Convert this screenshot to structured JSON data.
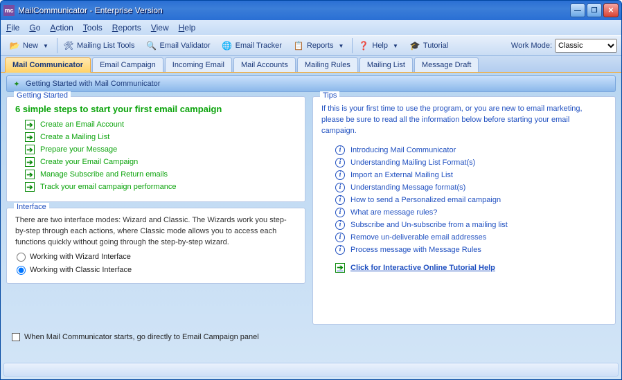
{
  "window": {
    "title": "MailCommunicator - Enterprise Version"
  },
  "menu": {
    "file": "File",
    "go": "Go",
    "action": "Action",
    "tools": "Tools",
    "reports": "Reports",
    "view": "View",
    "help": "Help"
  },
  "toolbar": {
    "new": "New",
    "mailing_list_tools": "Mailing List Tools",
    "email_validator": "Email Validator",
    "email_tracker": "Email Tracker",
    "reports": "Reports",
    "help": "Help",
    "tutorial": "Tutorial",
    "work_mode_label": "Work Mode:",
    "work_mode_value": "Classic"
  },
  "tabs": [
    "Mail Communicator",
    "Email Campaign",
    "Incoming Email",
    "Mail Accounts",
    "Mailing Rules",
    "Mailing List",
    "Message Draft"
  ],
  "subheader": "Getting Started with Mail Communicator",
  "getting_started": {
    "legend": "Getting Started",
    "heading": "6 simple steps to start your first email campaign",
    "steps": [
      "Create an Email Account",
      "Create a Mailing List",
      "Prepare your Message",
      "Create your Email Campaign",
      "Manage Subscribe and Return emails",
      "Track your email campaign performance"
    ]
  },
  "interface": {
    "legend": "Interface",
    "text": "There are two interface modes: Wizard and Classic. The Wizards work you step-by-step through each actions, where Classic mode allows you to access each functions quickly without going through the step-by-step wizard.",
    "wizard": "Working with Wizard Interface",
    "classic": "Working with Classic Interface"
  },
  "tips": {
    "legend": "Tips",
    "intro": "If this is your first time to use the program, or you are new to email marketing, please be sure to read all the information below before starting your email campaign.",
    "links": [
      "Introducing Mail Communicator",
      "Understanding Mailing List Format(s)",
      "Import an External Mailing List",
      "Understanding Message format(s)",
      "How to send a Personalized email campaign",
      "What are message rules?",
      "Subscribe and Un-subscribe from a mailing list",
      "Remove un-deliverable email addresses",
      "Process message with Message Rules"
    ],
    "tutorial": "Click for Interactive Online Tutorial Help"
  },
  "startup_chk": "When Mail Communicator starts, go directly to Email Campaign panel"
}
